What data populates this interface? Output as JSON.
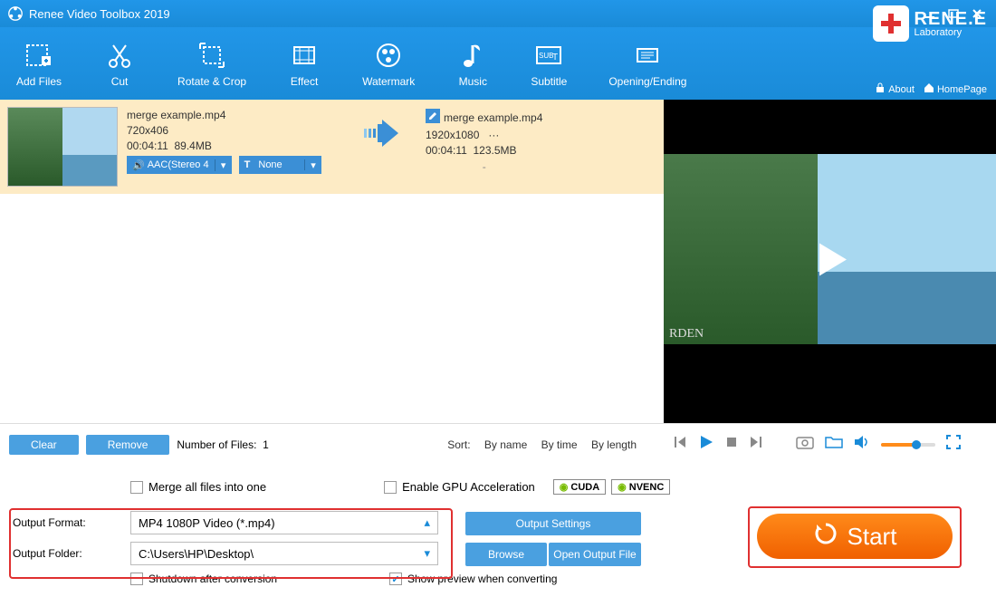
{
  "title": "Renee Video Toolbox 2019",
  "brand": {
    "name": "RENE.E",
    "sub": "Laboratory"
  },
  "links": {
    "about": "About",
    "homepage": "HomePage"
  },
  "toolbar": {
    "add_files": "Add Files",
    "cut": "Cut",
    "rotate_crop": "Rotate & Crop",
    "effect": "Effect",
    "watermark": "Watermark",
    "music": "Music",
    "subtitle": "Subtitle",
    "opening_ending": "Opening/Ending"
  },
  "file": {
    "src_name": "merge example.mp4",
    "src_res": "720x406",
    "src_dur": "00:04:11",
    "src_size": "89.4MB",
    "dst_name": "merge example.mp4",
    "dst_res": "1920x1080",
    "dst_more": "···",
    "dst_dur": "00:04:11",
    "dst_size": "123.5MB",
    "audio_chip": "AAC(Stereo 4",
    "sub_chip": "None",
    "dash": "-"
  },
  "preview_wm": "RDEN",
  "bottom": {
    "clear": "Clear",
    "remove": "Remove",
    "count_label": "Number of Files:",
    "count": "1",
    "sort_label": "Sort:",
    "by_name": "By name",
    "by_time": "By time",
    "by_length": "By length"
  },
  "settings": {
    "merge_all": "Merge all files into one",
    "gpu": "Enable GPU Acceleration",
    "cuda": "CUDA",
    "nvenc": "NVENC",
    "format_label": "Output Format:",
    "format_value": "MP4 1080P Video (*.mp4)",
    "folder_label": "Output Folder:",
    "folder_value": "C:\\Users\\HP\\Desktop\\",
    "output_settings": "Output Settings",
    "browse": "Browse",
    "open_output": "Open Output File",
    "shutdown": "Shutdown after conversion",
    "show_preview": "Show preview when converting",
    "start": "Start"
  }
}
